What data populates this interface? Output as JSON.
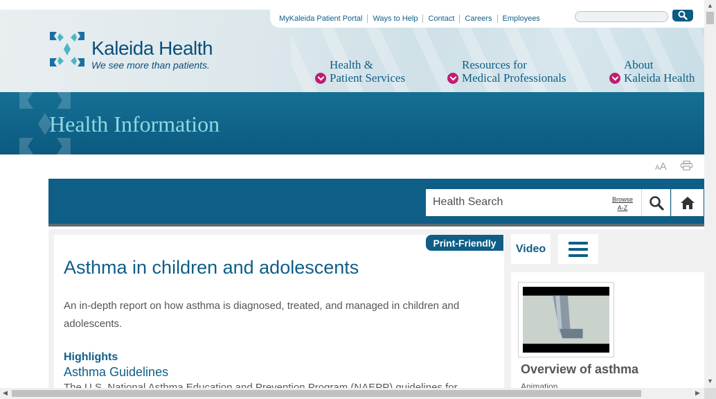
{
  "top_nav": {
    "links": [
      "MyKaleida Patient Portal",
      "Ways to Help",
      "Contact",
      "Careers",
      "Employees"
    ],
    "search_placeholder": ""
  },
  "logo": {
    "name": "Kaleida Health",
    "tagline": "We see more than patients."
  },
  "main_nav": [
    {
      "line1": "Health &",
      "line2": "Patient Services"
    },
    {
      "line1": "Resources for",
      "line2": "Medical Professionals"
    },
    {
      "line1": "About",
      "line2": "Kaleida Health"
    }
  ],
  "banner": {
    "title": "Health Information"
  },
  "tools": {
    "text_size_small": "A",
    "text_size_large": "A",
    "print_icon": "printer-icon"
  },
  "health_search": {
    "placeholder": "Health Search",
    "browse_line1": "Browse",
    "browse_line2": "A-Z",
    "search_icon": "magnifier-icon",
    "home_icon": "home-icon"
  },
  "article": {
    "print_label": "Print-Friendly",
    "title": "Asthma in children and adolescents",
    "description": "An in-depth report on how asthma is diagnosed, treated, and managed in children and adolescents.",
    "highlights_label": "Highlights",
    "highlight_link": "Asthma Guidelines",
    "cut_text": "The U.S. National Asthma Education and Prevention Program (NAEPP) guidelines for"
  },
  "sidebar": {
    "video_tab": "Video",
    "menu_icon": "hamburger-menu-icon",
    "video_title": "Overview of asthma",
    "video_type": "Animation"
  },
  "colors": {
    "primary": "#0e5e88",
    "accent": "#c01d73",
    "banner_text": "#8fd9e0"
  }
}
